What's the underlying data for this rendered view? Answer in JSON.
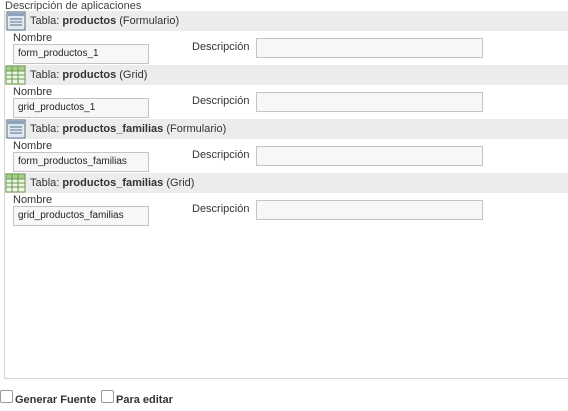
{
  "caption": "Descripción de aplicaciones",
  "sections": [
    {
      "prefix": "Tabla:",
      "table": "productos",
      "kind": "(Formulario)",
      "icon": "form-icon",
      "nombre_label": "Nombre",
      "nombre_value": "form_productos_1",
      "descripcion_label": "Descripción",
      "descripcion_value": ""
    },
    {
      "prefix": "Tabla:",
      "table": "productos",
      "kind": "(Grid)",
      "icon": "grid-icon",
      "nombre_label": "Nombre",
      "nombre_value": "grid_productos_1",
      "descripcion_label": "Descripción",
      "descripcion_value": ""
    },
    {
      "prefix": "Tabla:",
      "table": "productos_familias",
      "kind": "(Formulario)",
      "icon": "form-icon",
      "nombre_label": "Nombre",
      "nombre_value": "form_productos_familias",
      "descripcion_label": "Descripción",
      "descripcion_value": ""
    },
    {
      "prefix": "Tabla:",
      "table": "productos_familias",
      "kind": "(Grid)",
      "icon": "grid-icon",
      "nombre_label": "Nombre",
      "nombre_value": "grid_productos_familias",
      "descripcion_label": "Descripción",
      "descripcion_value": ""
    }
  ],
  "footer": {
    "generar_fuente_label": "Generar Fuente",
    "generar_fuente_checked": false,
    "para_editar_label": "Para editar",
    "para_editar_checked": false
  }
}
